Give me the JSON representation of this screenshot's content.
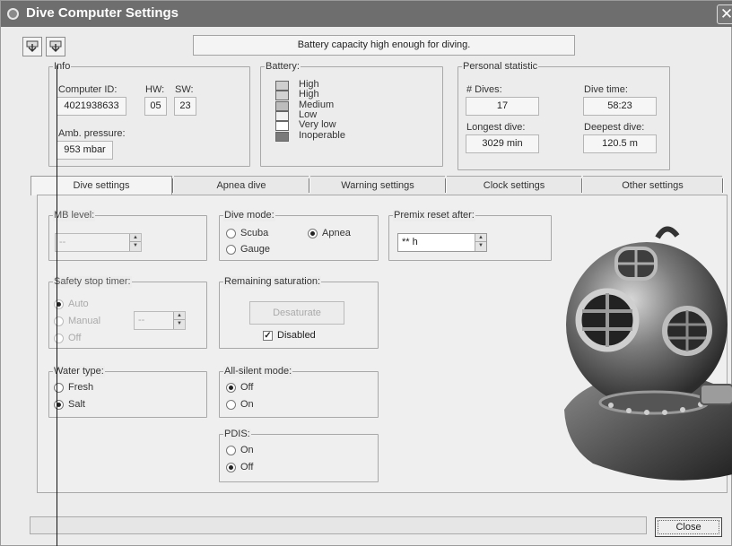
{
  "window": {
    "title": "Dive Computer Settings",
    "close_glyph": "✕"
  },
  "toolbar": {
    "buttons": [
      {
        "icon": "download-icon"
      },
      {
        "icon": "upload-icon"
      }
    ]
  },
  "status_message": "Battery capacity high enough for diving.",
  "info": {
    "legend": "Info",
    "computer_id_label": "Computer ID:",
    "computer_id": "4021938633",
    "hw_label": "HW:",
    "hw": "05",
    "sw_label": "SW:",
    "sw": "23",
    "amb_label": "Amb. pressure:",
    "amb_value": "953 mbar"
  },
  "battery": {
    "legend": "Battery:",
    "levels": [
      {
        "label": "High",
        "color": "#cfcfcf"
      },
      {
        "label": "High",
        "color": "#d2d2d2"
      },
      {
        "label": "Medium",
        "color": "#bdbdbd"
      },
      {
        "label": "Low",
        "color": "#f2f2f2"
      },
      {
        "label": "Very low",
        "color": "#ffffff"
      },
      {
        "label": "Inoperable",
        "color": "#7a7a7a"
      }
    ]
  },
  "personal": {
    "legend": "Personal statistic",
    "dives_label": "# Dives:",
    "dives": "17",
    "divetime_label": "Dive time:",
    "divetime": "58:23",
    "longest_label": "Longest dive:",
    "longest": "3029 min",
    "deepest_label": "Deepest dive:",
    "deepest": "120.5 m"
  },
  "tabs": [
    "Dive settings",
    "Apnea dive",
    "Warning settings",
    "Clock settings",
    "Other settings"
  ],
  "selected_tab": "Dive settings",
  "mb": {
    "legend": "MB level:",
    "value": "--"
  },
  "safety": {
    "legend": "Safety stop timer:",
    "options": [
      "Auto",
      "Manual",
      "Off"
    ],
    "manual_value": "--"
  },
  "water": {
    "legend": "Water type:",
    "options": [
      "Fresh",
      "Salt"
    ]
  },
  "divemode": {
    "legend": "Dive mode:",
    "options": [
      "Scuba",
      "Apnea",
      "Gauge"
    ]
  },
  "remaining": {
    "legend": "Remaining saturation:",
    "button": "Desaturate",
    "checkbox": "Disabled",
    "check_glyph": "✓"
  },
  "allsilent": {
    "legend": "All-silent mode:",
    "options": [
      "Off",
      "On"
    ]
  },
  "pdis": {
    "legend": "PDIS:",
    "options": [
      "On",
      "Off"
    ]
  },
  "premix": {
    "legend": "Premix reset after:",
    "value": "** h"
  },
  "spin_arrows": {
    "up": "▲",
    "down": "▼"
  },
  "close_button": "Close"
}
